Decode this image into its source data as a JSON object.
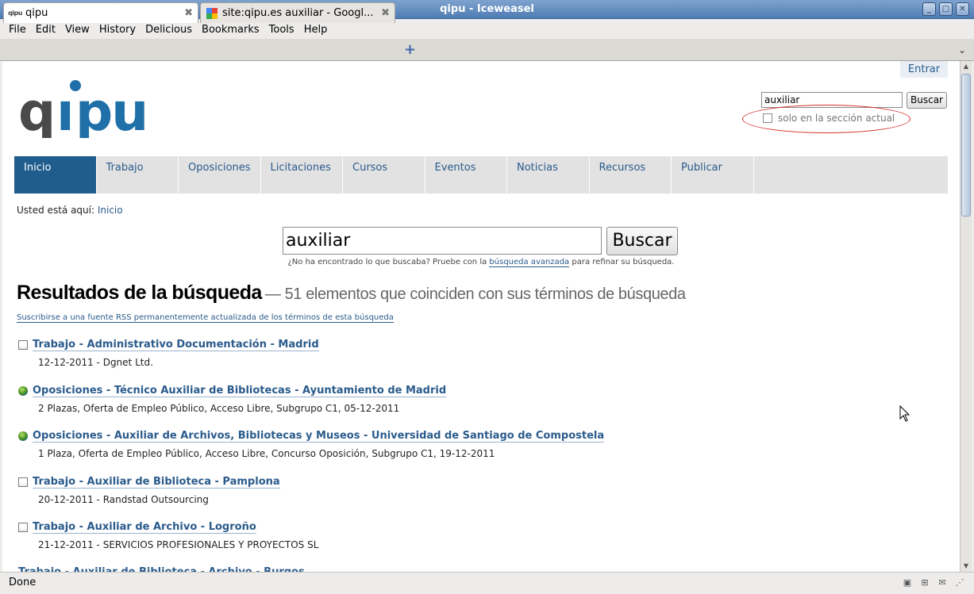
{
  "window": {
    "title": "qipu - Iceweasel"
  },
  "menubar": [
    "File",
    "Edit",
    "View",
    "History",
    "Delicious",
    "Bookmarks",
    "Tools",
    "Help"
  ],
  "tabs": [
    {
      "label": "qipu",
      "favicon": "qipu",
      "active": true
    },
    {
      "label": "site:qipu.es auxiliar - Googl...",
      "favicon": "google",
      "active": false
    }
  ],
  "page": {
    "login_link": "Entrar",
    "logo_text": "qipu",
    "top_search": {
      "value": "auxiliar",
      "button": "Buscar",
      "checkbox_label": "solo en la sección actual",
      "checked": false
    },
    "nav": [
      "Inicio",
      "Trabajo",
      "Oposiciones",
      "Licitaciones",
      "Cursos",
      "Eventos",
      "Noticias",
      "Recursos",
      "Publicar"
    ],
    "nav_active_index": 0,
    "breadcrumb": {
      "prefix": "Usted está aquí:",
      "link": "Inicio"
    },
    "main_search": {
      "value": "auxiliar",
      "button": "Buscar"
    },
    "hint": {
      "before": "¿No ha encontrado lo que buscaba? Pruebe con la",
      "link": "búsqueda avanzada",
      "after": "para refinar su búsqueda."
    },
    "results_heading": "Resultados de la búsqueda",
    "results_summary": "— 51 elementos que coinciden con sus términos de búsqueda",
    "rss_link": "Suscribirse a una fuente RSS permanentemente actualizada de los términos de esta búsqueda",
    "results": [
      {
        "icon": "page-icon",
        "title": "Trabajo - Administrativo Documentación - Madrid",
        "desc": "12-12-2011 - Dgnet Ltd."
      },
      {
        "icon": "globe-icon",
        "title": "Oposiciones - Técnico Auxiliar de Bibliotecas - Ayuntamiento de Madrid",
        "desc": "2 Plazas, Oferta de Empleo Público, Acceso Libre, Subgrupo C1, 05-12-2011"
      },
      {
        "icon": "globe-icon",
        "title": "Oposiciones - Auxiliar de Archivos, Bibliotecas y Museos - Universidad de Santiago de Compostela",
        "desc": "1 Plaza, Oferta de Empleo Público, Acceso Libre, Concurso Oposición, Subgrupo C1, 19-12-2011"
      },
      {
        "icon": "page-icon",
        "title": "Trabajo - Auxiliar de Biblioteca - Pamplona",
        "desc": "20-12-2011 - Randstad Outsourcing"
      },
      {
        "icon": "page-icon",
        "title": "Trabajo - Auxiliar de Archivo - Logroño",
        "desc": "21-12-2011 - SERVICIOS PROFESIONALES Y PROYECTOS SL"
      }
    ],
    "partial_result": "Trabajo - Auxiliar de Biblioteca - Archivo - Burgos"
  },
  "status": {
    "text": "Done"
  },
  "colors": {
    "brand": "#205c8c",
    "link": "#2a5b8c",
    "logo_dark": "#4a4a4a",
    "logo_accent": "#1f6fa8",
    "annotation": "#d4302b"
  }
}
